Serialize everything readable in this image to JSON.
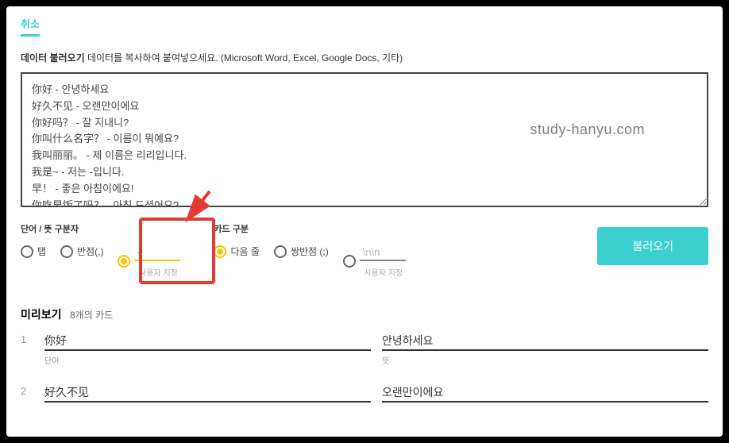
{
  "cancel": "취소",
  "instruction": {
    "bold": "데이터 불러오기",
    "rest": " 데이터를 복사하여 붙여넣으세요. (Microsoft Word, Excel, Google Docs, 기타)"
  },
  "textarea_value": "你好 - 안녕하세요\n好久不见 - 오랜만이에요\n你好吗？ - 잘 지내니?\n你叫什么名字？ - 이름이 뭐예요?\n我叫丽丽。 - 제 이름은 리리입니다.\n我是~ - 저는 -입니다.\n早！ - 좋은 아침이에요!\n你吃早饭了吗？ - 아침 드셨어요?",
  "watermark": "study-hanyu.com",
  "word_sep": {
    "label": "단어 / 뜻 구분자",
    "opt_tab": "탭",
    "opt_comma": "반점(,)",
    "custom_value": "- ",
    "custom_label": "사용자 지정"
  },
  "card_sep": {
    "label": "카드 구분",
    "opt_newline": "다음 줄",
    "opt_semicolon": "쌍반점 (;)",
    "custom_value": "\\n\\n",
    "custom_label": "사용자 지정"
  },
  "import_btn": "불러오기",
  "preview": {
    "title": "미리보기",
    "count": "8개의 카드",
    "word_col": "단어",
    "meaning_col": "뜻",
    "cards": [
      {
        "num": "1",
        "front": "你好",
        "back": "안녕하세요"
      },
      {
        "num": "2",
        "front": "好久不见",
        "back": "오랜만이에요"
      }
    ]
  }
}
